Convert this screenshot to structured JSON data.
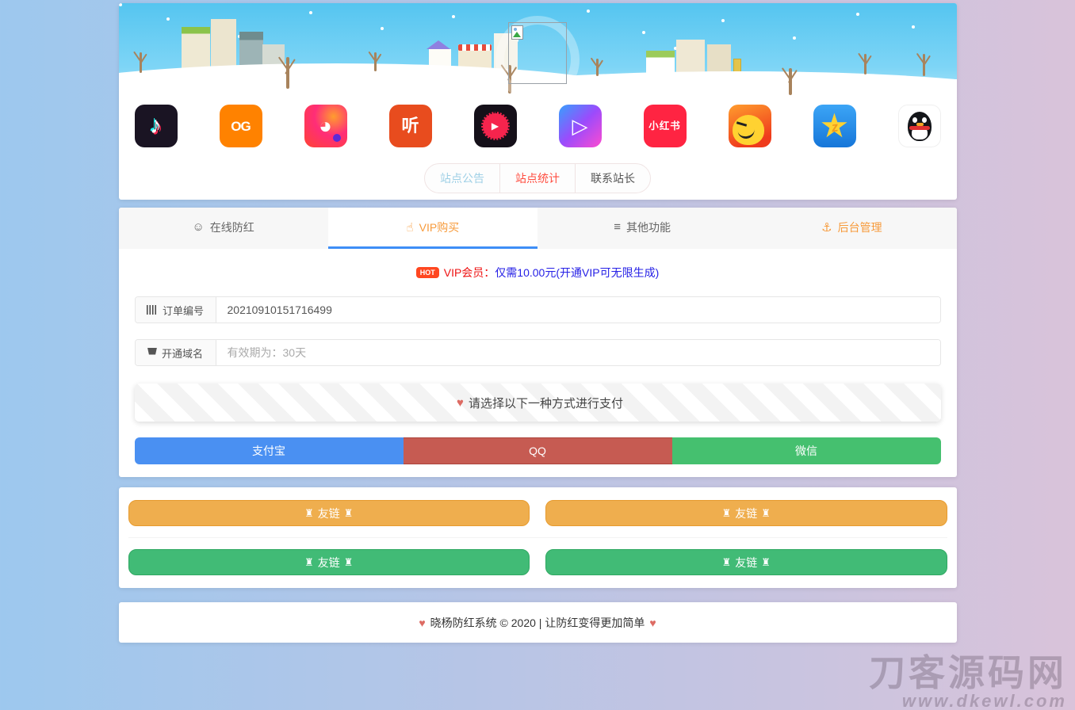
{
  "apps": [
    {
      "name": "douyin",
      "glyph": "♪",
      "bg": "#1a1423"
    },
    {
      "name": "kuaishou",
      "glyph": "OG",
      "bg": "#ff8200"
    },
    {
      "name": "parrot-video",
      "glyph": "◕",
      "bg": "#ff2d78"
    },
    {
      "name": "tingshu",
      "glyph": "听",
      "bg": "#e84c1e"
    },
    {
      "name": "red-play",
      "glyph": "▶",
      "bg": "#151019",
      "accent": "#f5244d"
    },
    {
      "name": "weishi",
      "glyph": "▷",
      "bg": "#9b4bfc"
    },
    {
      "name": "xiaohongshu",
      "glyph": "小红书",
      "bg": "#ff2442"
    },
    {
      "name": "pipixia",
      "glyph": "",
      "bg": "#f0581d",
      "accent": "#ffd231"
    },
    {
      "name": "qzone",
      "glyph": "★",
      "glyph2": "z",
      "bg": "#1e88e5",
      "accent": "#ffd231"
    },
    {
      "name": "qq",
      "glyph": "",
      "bg": "#ffffff"
    }
  ],
  "notice_pills": [
    {
      "label": "站点公告",
      "color": "#9fd0e6"
    },
    {
      "label": "站点统计",
      "color": "#ff4d40"
    },
    {
      "label": "联系站长",
      "color": "#555555"
    }
  ],
  "main_tabs": [
    {
      "icon": "☺",
      "label": "在线防红",
      "active": false
    },
    {
      "icon": "☝",
      "label": "VIP购买",
      "active": true
    },
    {
      "icon": "≡",
      "label": "其他功能",
      "active": false
    },
    {
      "icon": "⚓",
      "label": "后台管理",
      "active": false
    }
  ],
  "accent": {
    "tab_underline": "#3e8ef7",
    "tab_orange": "#f79b3c",
    "heart": "#dd6b63"
  },
  "vip_banner": {
    "badge": "HOT",
    "title": "VIP会员：",
    "desc": "仅需10.00元(开通VIP可无限生成)",
    "title_color": "#ee1111",
    "desc_color": "#2620e6"
  },
  "order_form": {
    "order_label": "订单编号",
    "order_value": "20210910151716499",
    "domain_label": "开通域名",
    "domain_placeholder": "有效期为：30天"
  },
  "payment": {
    "heart": "♥",
    "notice": "请选择以下一种方式进行支付",
    "methods": [
      {
        "label": "支付宝",
        "color": "#4a90f2"
      },
      {
        "label": "QQ",
        "color": "#c65b52"
      },
      {
        "label": "微信",
        "color": "#45c06f"
      }
    ]
  },
  "friend_links": {
    "icon": "♜",
    "items": [
      {
        "label": "友链",
        "color": "#efae4e"
      },
      {
        "label": "友链",
        "color": "#efae4e"
      },
      {
        "label": "友链",
        "color": "#41bb76"
      },
      {
        "label": "友链",
        "color": "#41bb76"
      }
    ]
  },
  "footer": {
    "heart": "♥",
    "text": "晓杨防红系统 © 2020 | 让防红变得更加简单"
  },
  "watermark": {
    "line1": "刀客源码网",
    "line2": "www.dkewl.com"
  }
}
